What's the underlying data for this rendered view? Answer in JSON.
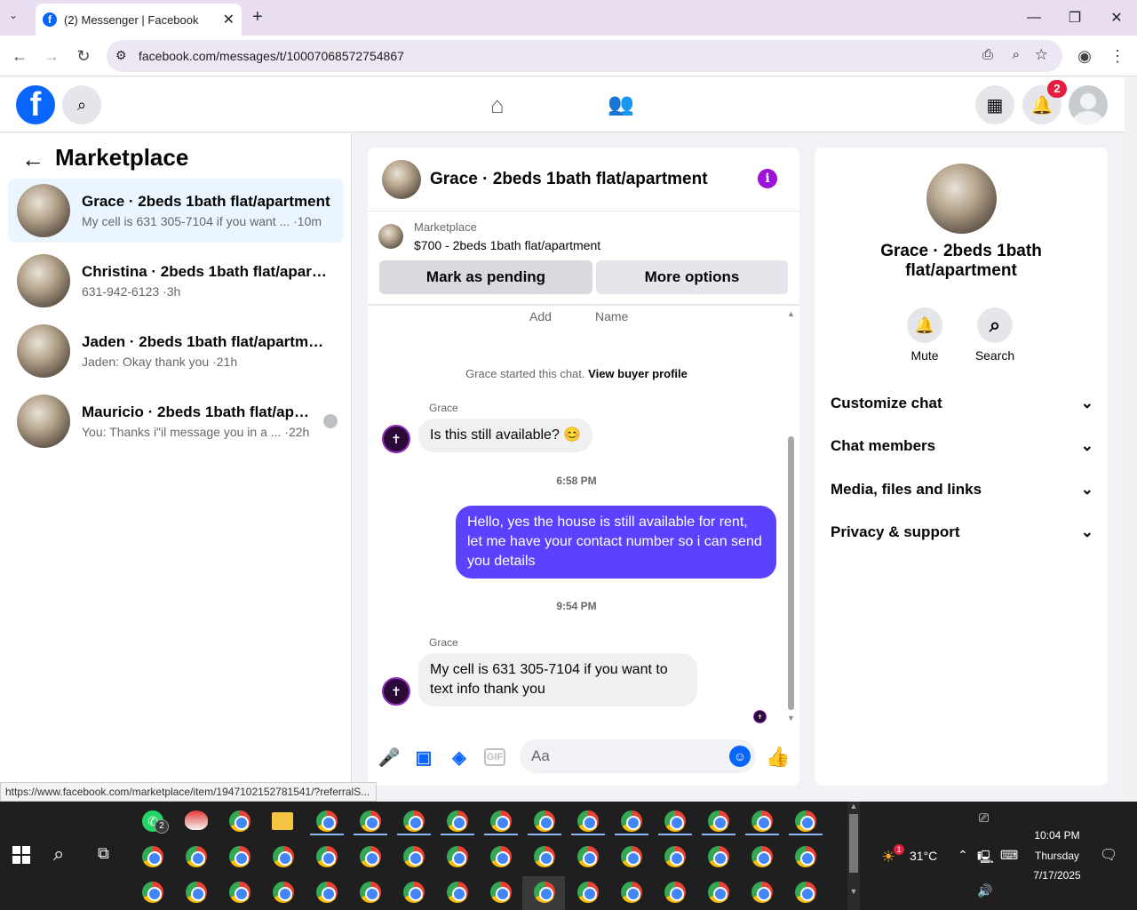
{
  "browser": {
    "tab_title": "(2) Messenger | Facebook",
    "url": "facebook.com/messages/t/10007068572754867",
    "status_url": "https://www.facebook.com/marketplace/item/1947102152781541/?referralS..."
  },
  "header": {
    "notification_count": "2"
  },
  "sidebar": {
    "title": "Marketplace",
    "conversations": [
      {
        "name": "Grace · 2beds 1bath flat/apartment",
        "preview": "My cell is 631 305-7104 if you want ... ·10m"
      },
      {
        "name": "Christina · 2beds 1bath flat/apartm...",
        "preview": "631-942-6123 ·3h"
      },
      {
        "name": "Jaden · 2beds 1bath flat/apartment",
        "preview": "Jaden: Okay thank you ·21h"
      },
      {
        "name": "Mauricio · 2beds 1bath flat/apar...",
        "preview": "You: Thanks i\"il message you in a ... ·22h"
      }
    ]
  },
  "chat": {
    "title": "Grace · 2beds 1bath flat/apartment",
    "listing_source": "Marketplace",
    "listing_title": "$700 - 2beds 1bath flat/apartment",
    "mark_pending": "Mark as pending",
    "more_options": "More options",
    "col_add": "Add",
    "col_name": "Name",
    "started_text": "Grace started this chat.",
    "view_profile": "View buyer profile",
    "messages": [
      {
        "sender": "Grace",
        "text": "Is this still available? 😊"
      },
      {
        "time": "6:58 PM"
      },
      {
        "text": "Hello, yes the house is still available for rent, let me have your contact number so i can send you details"
      },
      {
        "time": "9:54 PM"
      },
      {
        "sender": "Grace",
        "text": "My cell is 631 305-7104 if you want to text info thank you"
      }
    ],
    "composer_placeholder": "Aa"
  },
  "details": {
    "name": "Grace · 2beds 1bath flat/apartment",
    "mute": "Mute",
    "search": "Search",
    "sections": [
      "Customize chat",
      "Chat members",
      "Media, files and links",
      "Privacy & support"
    ]
  },
  "taskbar": {
    "whatsapp_badge": "2",
    "temperature": "31°C",
    "weather_badge": "1",
    "time": "10:04 PM",
    "day": "Thursday",
    "date": "7/17/2025"
  }
}
